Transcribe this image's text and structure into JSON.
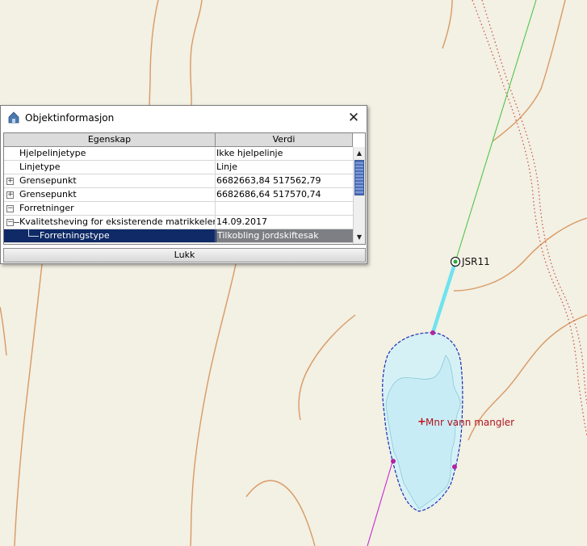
{
  "map": {
    "point_label": "JSR11",
    "annotation": "Mnr vann mangler"
  },
  "dialog": {
    "title": "Objektinformasjon",
    "icon": "house-icon",
    "columns": [
      "Egenskap",
      "Verdi"
    ],
    "rows": [
      {
        "property": "Hjelpelinjetype",
        "value": "Ikke hjelpelinje",
        "expander": ""
      },
      {
        "property": "Linjetype",
        "value": "Linje",
        "expander": ""
      },
      {
        "property": "Grensepunkt",
        "value": "6682663,84 517562,79",
        "expander": "+"
      },
      {
        "property": "Grensepunkt",
        "value": "6682686,64 517570,74",
        "expander": "+"
      },
      {
        "property": "Forretninger",
        "value": "",
        "expander": "−"
      },
      {
        "property": "Kvalitetsheving for eksisterende matrikkelenhet",
        "value": "14.09.2017",
        "expander": "−"
      },
      {
        "property": "Forretningstype",
        "value": "Tilkobling jordskiftesak",
        "expander": "",
        "selected": true
      }
    ],
    "close_button": "Lukk"
  },
  "colors": {
    "map_background": "#f3f0e4",
    "contour": "#d89a63",
    "water": "#d6f1f6",
    "boundary": "#1a2fb0",
    "selection": "#0f2a66"
  }
}
